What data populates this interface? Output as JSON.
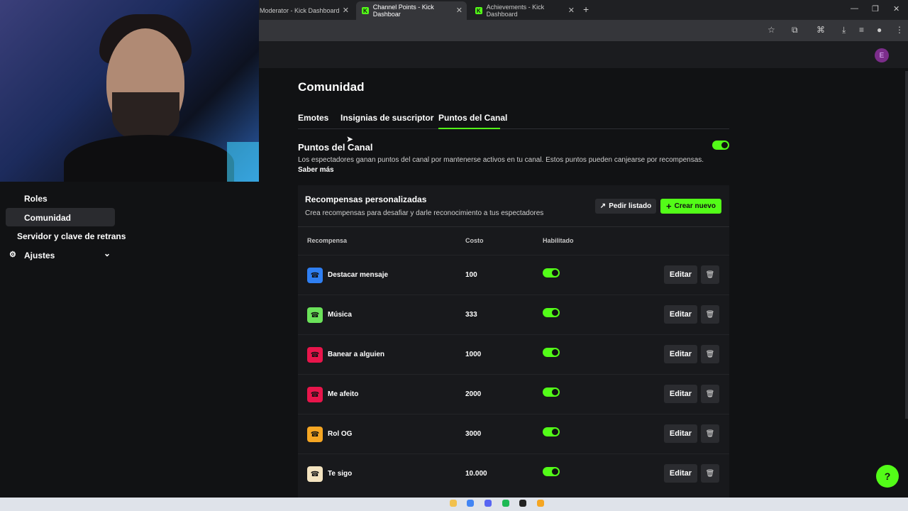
{
  "browser": {
    "tabs": [
      {
        "title": "Moderator - Kick Dashboard",
        "active": false
      },
      {
        "title": "Channel Points - Kick Dashboar",
        "active": true
      },
      {
        "title": "Achievements - Kick Dashboard",
        "active": false
      }
    ],
    "new_tab": "+",
    "window": {
      "minimize": "—",
      "restore": "❐",
      "close": "✕"
    }
  },
  "sidebar": {
    "items": [
      {
        "label": "Roles"
      },
      {
        "label": "Comunidad",
        "selected": true
      },
      {
        "label": "Servidor y clave de retrans"
      },
      {
        "label": "Ajustes",
        "icon": "gear-icon",
        "expand": "chevron-down-icon"
      }
    ]
  },
  "page": {
    "title": "Comunidad",
    "tabs": [
      "Emotes",
      "Insignias de suscriptor",
      "Puntos del Canal"
    ],
    "active_tab": "Puntos del Canal"
  },
  "channel_points": {
    "title": "Puntos del Canal",
    "enabled": true,
    "description": "Los espectadores ganan puntos del canal por mantenerse activos en tu canal. Estos puntos pueden canjearse por recompensas.",
    "learn_more": "Saber más"
  },
  "rewards": {
    "title": "Recompensas personalizadas",
    "subtitle": "Crea recompensas para desafiar y darle reconocimiento a tus espectadores",
    "request_list_label": "Pedir listado",
    "create_label": "Crear nuevo",
    "columns": {
      "reward": "Recompensa",
      "cost": "Costo",
      "enabled": "Habilitado"
    },
    "edit_label": "Editar",
    "items": [
      {
        "name": "Destacar mensaje",
        "cost": "100",
        "enabled": true,
        "color": "#2f7ff2"
      },
      {
        "name": "Música",
        "cost": "333",
        "enabled": true,
        "color": "#6be25a"
      },
      {
        "name": "Banear a alguien",
        "cost": "1000",
        "enabled": true,
        "color": "#e8154b"
      },
      {
        "name": "Me afeito",
        "cost": "2000",
        "enabled": true,
        "color": "#e8154b"
      },
      {
        "name": "Rol OG",
        "cost": "3000",
        "enabled": true,
        "color": "#f5a623"
      },
      {
        "name": "Te sigo",
        "cost": "10.000",
        "enabled": true,
        "color": "#f3e3c0"
      }
    ]
  },
  "colors": {
    "accent": "#53fc18",
    "background": "#111214",
    "card": "#18191c"
  }
}
